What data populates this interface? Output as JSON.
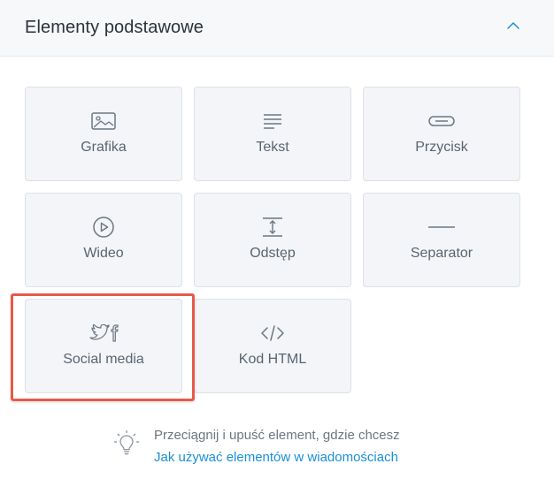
{
  "panel": {
    "title": "Elementy podstawowe",
    "accent_color": "#1a8fd8",
    "collapse_icon": "chevron-up-icon"
  },
  "tiles": [
    {
      "label": "Grafika",
      "icon": "image-icon"
    },
    {
      "label": "Tekst",
      "icon": "text-lines-icon"
    },
    {
      "label": "Przycisk",
      "icon": "button-icon"
    },
    {
      "label": "Wideo",
      "icon": "play-circle-icon"
    },
    {
      "label": "Odstęp",
      "icon": "spacing-icon"
    },
    {
      "label": "Separator",
      "icon": "divider-icon"
    },
    {
      "label": "Social media",
      "icon": "twitter-facebook-icon",
      "highlighted": true
    },
    {
      "label": "Kod HTML",
      "icon": "code-icon"
    }
  ],
  "hint": {
    "text": "Przeciągnij i upuść element, gdzie chcesz",
    "link": "Jak używać elementów w wiadomościach",
    "icon": "lightbulb-icon"
  },
  "highlight_color": "#e8594a"
}
